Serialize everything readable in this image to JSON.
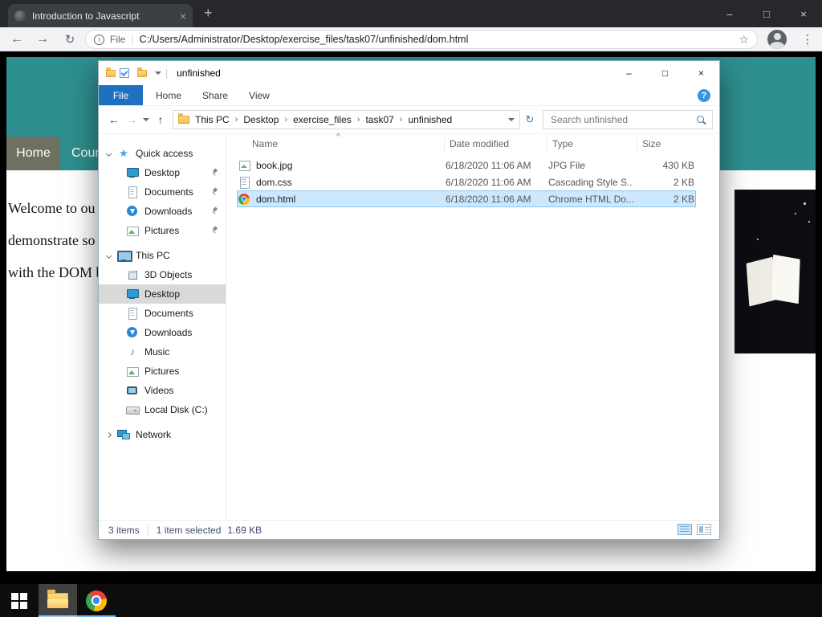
{
  "colors": {
    "site_teal": "#2e8f8f",
    "nav_home_bg": "#6f705f",
    "selection_blue": "#cce8ff",
    "ribbon_file_tab_blue": "#1e70c1",
    "taskbar_underline": "#76b9ed"
  },
  "glyphs": {
    "back": "←",
    "forward": "→",
    "up": "↑",
    "reload": "↻",
    "star": "☆",
    "menu": "⋮",
    "plus": "+",
    "minimize": "–",
    "maximize": "□",
    "close": "×",
    "info": "i",
    "pipe": "|",
    "help": "?",
    "crumb_sep": "›",
    "sort_asc": "^",
    "quick_access_star": "★",
    "music_note": "♪"
  },
  "browser": {
    "tab_title": "Introduction to Javascript",
    "address": {
      "scheme_label": "File",
      "url": "C:/Users/Administrator/Desktop/exercise_files/task07/unfinished/dom.html"
    }
  },
  "webpage": {
    "nav_home": "Home",
    "nav_courses": "Cours",
    "lines": [
      "Welcome to ou",
      "demonstrate so",
      "with the DOM b"
    ]
  },
  "explorer": {
    "title": "unfinished",
    "ribbon": {
      "file_tab": "File",
      "tabs": [
        "Home",
        "Share",
        "View"
      ]
    },
    "breadcrumb": [
      "This PC",
      "Desktop",
      "exercise_files",
      "task07",
      "unfinished"
    ],
    "search_placeholder": "Search unfinished",
    "sidebar": {
      "quick_access": {
        "label": "Quick access",
        "items": [
          "Desktop",
          "Documents",
          "Downloads",
          "Pictures"
        ]
      },
      "this_pc": {
        "label": "This PC",
        "items": [
          "3D Objects",
          "Desktop",
          "Documents",
          "Downloads",
          "Music",
          "Pictures",
          "Videos",
          "Local Disk (C:)"
        ]
      },
      "network_label": "Network"
    },
    "columns": [
      "Name",
      "Date modified",
      "Type",
      "Size"
    ],
    "files": [
      {
        "name": "book.jpg",
        "modified": "6/18/2020 11:06 AM",
        "type": "JPG File",
        "size": "430 KB",
        "selected": false
      },
      {
        "name": "dom.css",
        "modified": "6/18/2020 11:06 AM",
        "type": "Cascading Style S...",
        "size": "2 KB",
        "selected": false
      },
      {
        "name": "dom.html",
        "modified": "6/18/2020 11:06 AM",
        "type": "Chrome HTML Do...",
        "size": "2 KB",
        "selected": true
      }
    ],
    "status": {
      "items_count": "3 items",
      "selected": "1 item selected",
      "selected_size": "1.69 KB"
    }
  }
}
